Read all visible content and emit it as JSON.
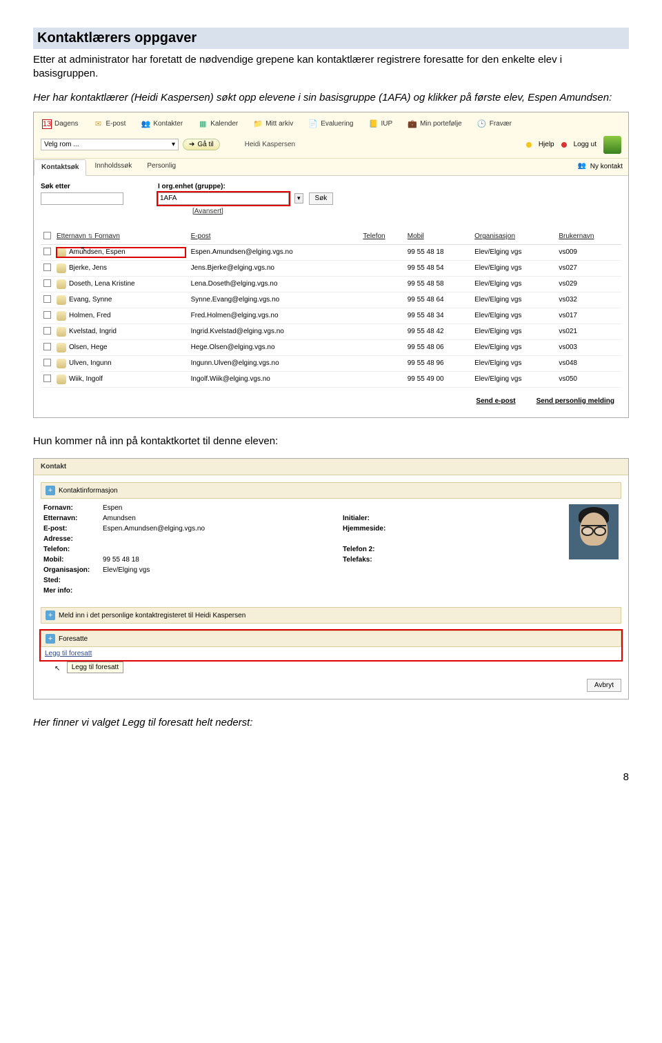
{
  "doc": {
    "title": "Kontaktlærers oppgaver",
    "intro": "Etter at administrator har foretatt de nødvendige grepene kan kontaktlærer registrere foresatte for den enkelte elev i basisgruppen.",
    "note1": "Her har kontaktlærer (Heidi Kaspersen) søkt opp elevene i sin basisgruppe (1AFA) og klikker på første elev, Espen Amundsen:",
    "caption2": "Hun kommer nå inn på kontaktkortet til denne eleven:",
    "footer": "Her finner vi valget Legg til foresatt helt nederst:",
    "page_num": "8"
  },
  "shot1": {
    "tabs": {
      "dagens": "Dagens",
      "epost": "E-post",
      "kontakter": "Kontakter",
      "kalender": "Kalender",
      "mittarkiv": "Mitt arkiv",
      "evaluering": "Evaluering",
      "iup": "IUP",
      "portefolje": "Min portefølje",
      "fravaer": "Fravær"
    },
    "room_placeholder": "Velg rom ...",
    "gatil": "Gå til",
    "user": "Heidi Kaspersen",
    "hjelp": "Hjelp",
    "loggut": "Logg ut",
    "subtabs": {
      "kontaktsok": "Kontaktsøk",
      "innholdssok": "Innholdssøk",
      "personlig": "Personlig"
    },
    "nykontakt": "Ny kontakt",
    "search": {
      "sok_etter": "Søk etter",
      "org_enhet": "I org.enhet (gruppe):",
      "org_value": "1AFA",
      "sok_btn": "Søk",
      "avansert": "[Avansert]"
    },
    "headers": {
      "etn": "Etternavn",
      "fn": "Fornavn",
      "ep": "E-post",
      "tlf": "Telefon",
      "mob": "Mobil",
      "org": "Organisasjon",
      "brk": "Brukernavn"
    },
    "rows": [
      {
        "name": "Amundsen, Espen",
        "email": "Espen.Amundsen@elging.vgs.no",
        "mob": "99 55 48 18",
        "org": "Elev/Elging vgs",
        "user": "vs009",
        "hi": true
      },
      {
        "name": "Bjerke, Jens",
        "email": "Jens.Bjerke@elging.vgs.no",
        "mob": "99 55 48 54",
        "org": "Elev/Elging vgs",
        "user": "vs027"
      },
      {
        "name": "Doseth, Lena Kristine",
        "email": "Lena.Doseth@elging.vgs.no",
        "mob": "99 55 48 58",
        "org": "Elev/Elging vgs",
        "user": "vs029"
      },
      {
        "name": "Evang, Synne",
        "email": "Synne.Evang@elging.vgs.no",
        "mob": "99 55 48 64",
        "org": "Elev/Elging vgs",
        "user": "vs032"
      },
      {
        "name": "Holmen, Fred",
        "email": "Fred.Holmen@elging.vgs.no",
        "mob": "99 55 48 34",
        "org": "Elev/Elging vgs",
        "user": "vs017"
      },
      {
        "name": "Kvelstad, Ingrid",
        "email": "Ingrid.Kvelstad@elging.vgs.no",
        "mob": "99 55 48 42",
        "org": "Elev/Elging vgs",
        "user": "vs021"
      },
      {
        "name": "Olsen, Hege",
        "email": "Hege.Olsen@elging.vgs.no",
        "mob": "99 55 48 06",
        "org": "Elev/Elging vgs",
        "user": "vs003"
      },
      {
        "name": "Ulven, Ingunn",
        "email": "Ingunn.Ulven@elging.vgs.no",
        "mob": "99 55 48 96",
        "org": "Elev/Elging vgs",
        "user": "vs048"
      },
      {
        "name": "Wiik, Ingolf",
        "email": "Ingolf.Wiik@elging.vgs.no",
        "mob": "99 55 49 00",
        "org": "Elev/Elging vgs",
        "user": "vs050"
      }
    ],
    "send_epost": "Send e-post",
    "send_pm": "Send personlig melding"
  },
  "shot2": {
    "header": "Kontakt",
    "info_title": "Kontaktinformasjon",
    "labels": {
      "fornavn": "Fornavn:",
      "etternavn": "Etternavn:",
      "epost": "E-post:",
      "adresse": "Adresse:",
      "telefon": "Telefon:",
      "mobil": "Mobil:",
      "organisasjon": "Organisasjon:",
      "sted": "Sted:",
      "merinfo": "Mer info:",
      "initialer": "Initialer:",
      "hjemmeside": "Hjemmeside:",
      "telefon2": "Telefon 2:",
      "telefaks": "Telefaks:"
    },
    "values": {
      "fornavn": "Espen",
      "etternavn": "Amundsen",
      "epost": "Espen.Amundsen@elging.vgs.no",
      "mobil": "99 55 48 18",
      "organisasjon": "Elev/Elging vgs"
    },
    "meld": "Meld inn i det personlige kontaktregisteret til Heidi Kaspersen",
    "foresatte": "Foresatte",
    "legg_til": "Legg til foresatt",
    "tooltip": "Legg til foresatt",
    "avbryt": "Avbryt"
  }
}
